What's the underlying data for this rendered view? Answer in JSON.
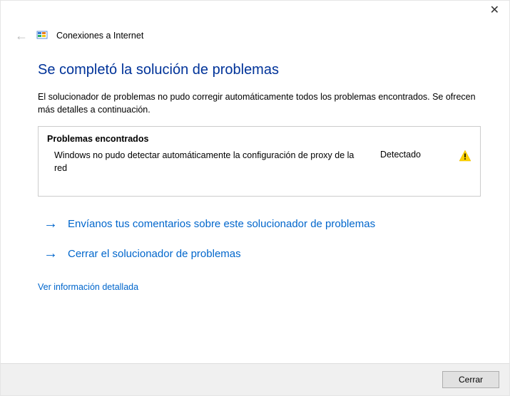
{
  "window": {
    "title": "Conexiones a Internet"
  },
  "main": {
    "heading": "Se completó la solución de problemas",
    "description": "El solucionador de problemas no pudo corregir automáticamente todos los problemas encontrados. Se ofrecen más detalles a continuación."
  },
  "problems": {
    "header": "Problemas encontrados",
    "items": [
      {
        "text": "Windows no pudo detectar automáticamente la configuración de proxy de la red",
        "status": "Detectado"
      }
    ]
  },
  "actions": {
    "feedback": "Envíanos tus comentarios sobre este solucionador de problemas",
    "close_troubleshooter": "Cerrar el solucionador de problemas",
    "details": "Ver información detallada"
  },
  "footer": {
    "close_button": "Cerrar"
  }
}
